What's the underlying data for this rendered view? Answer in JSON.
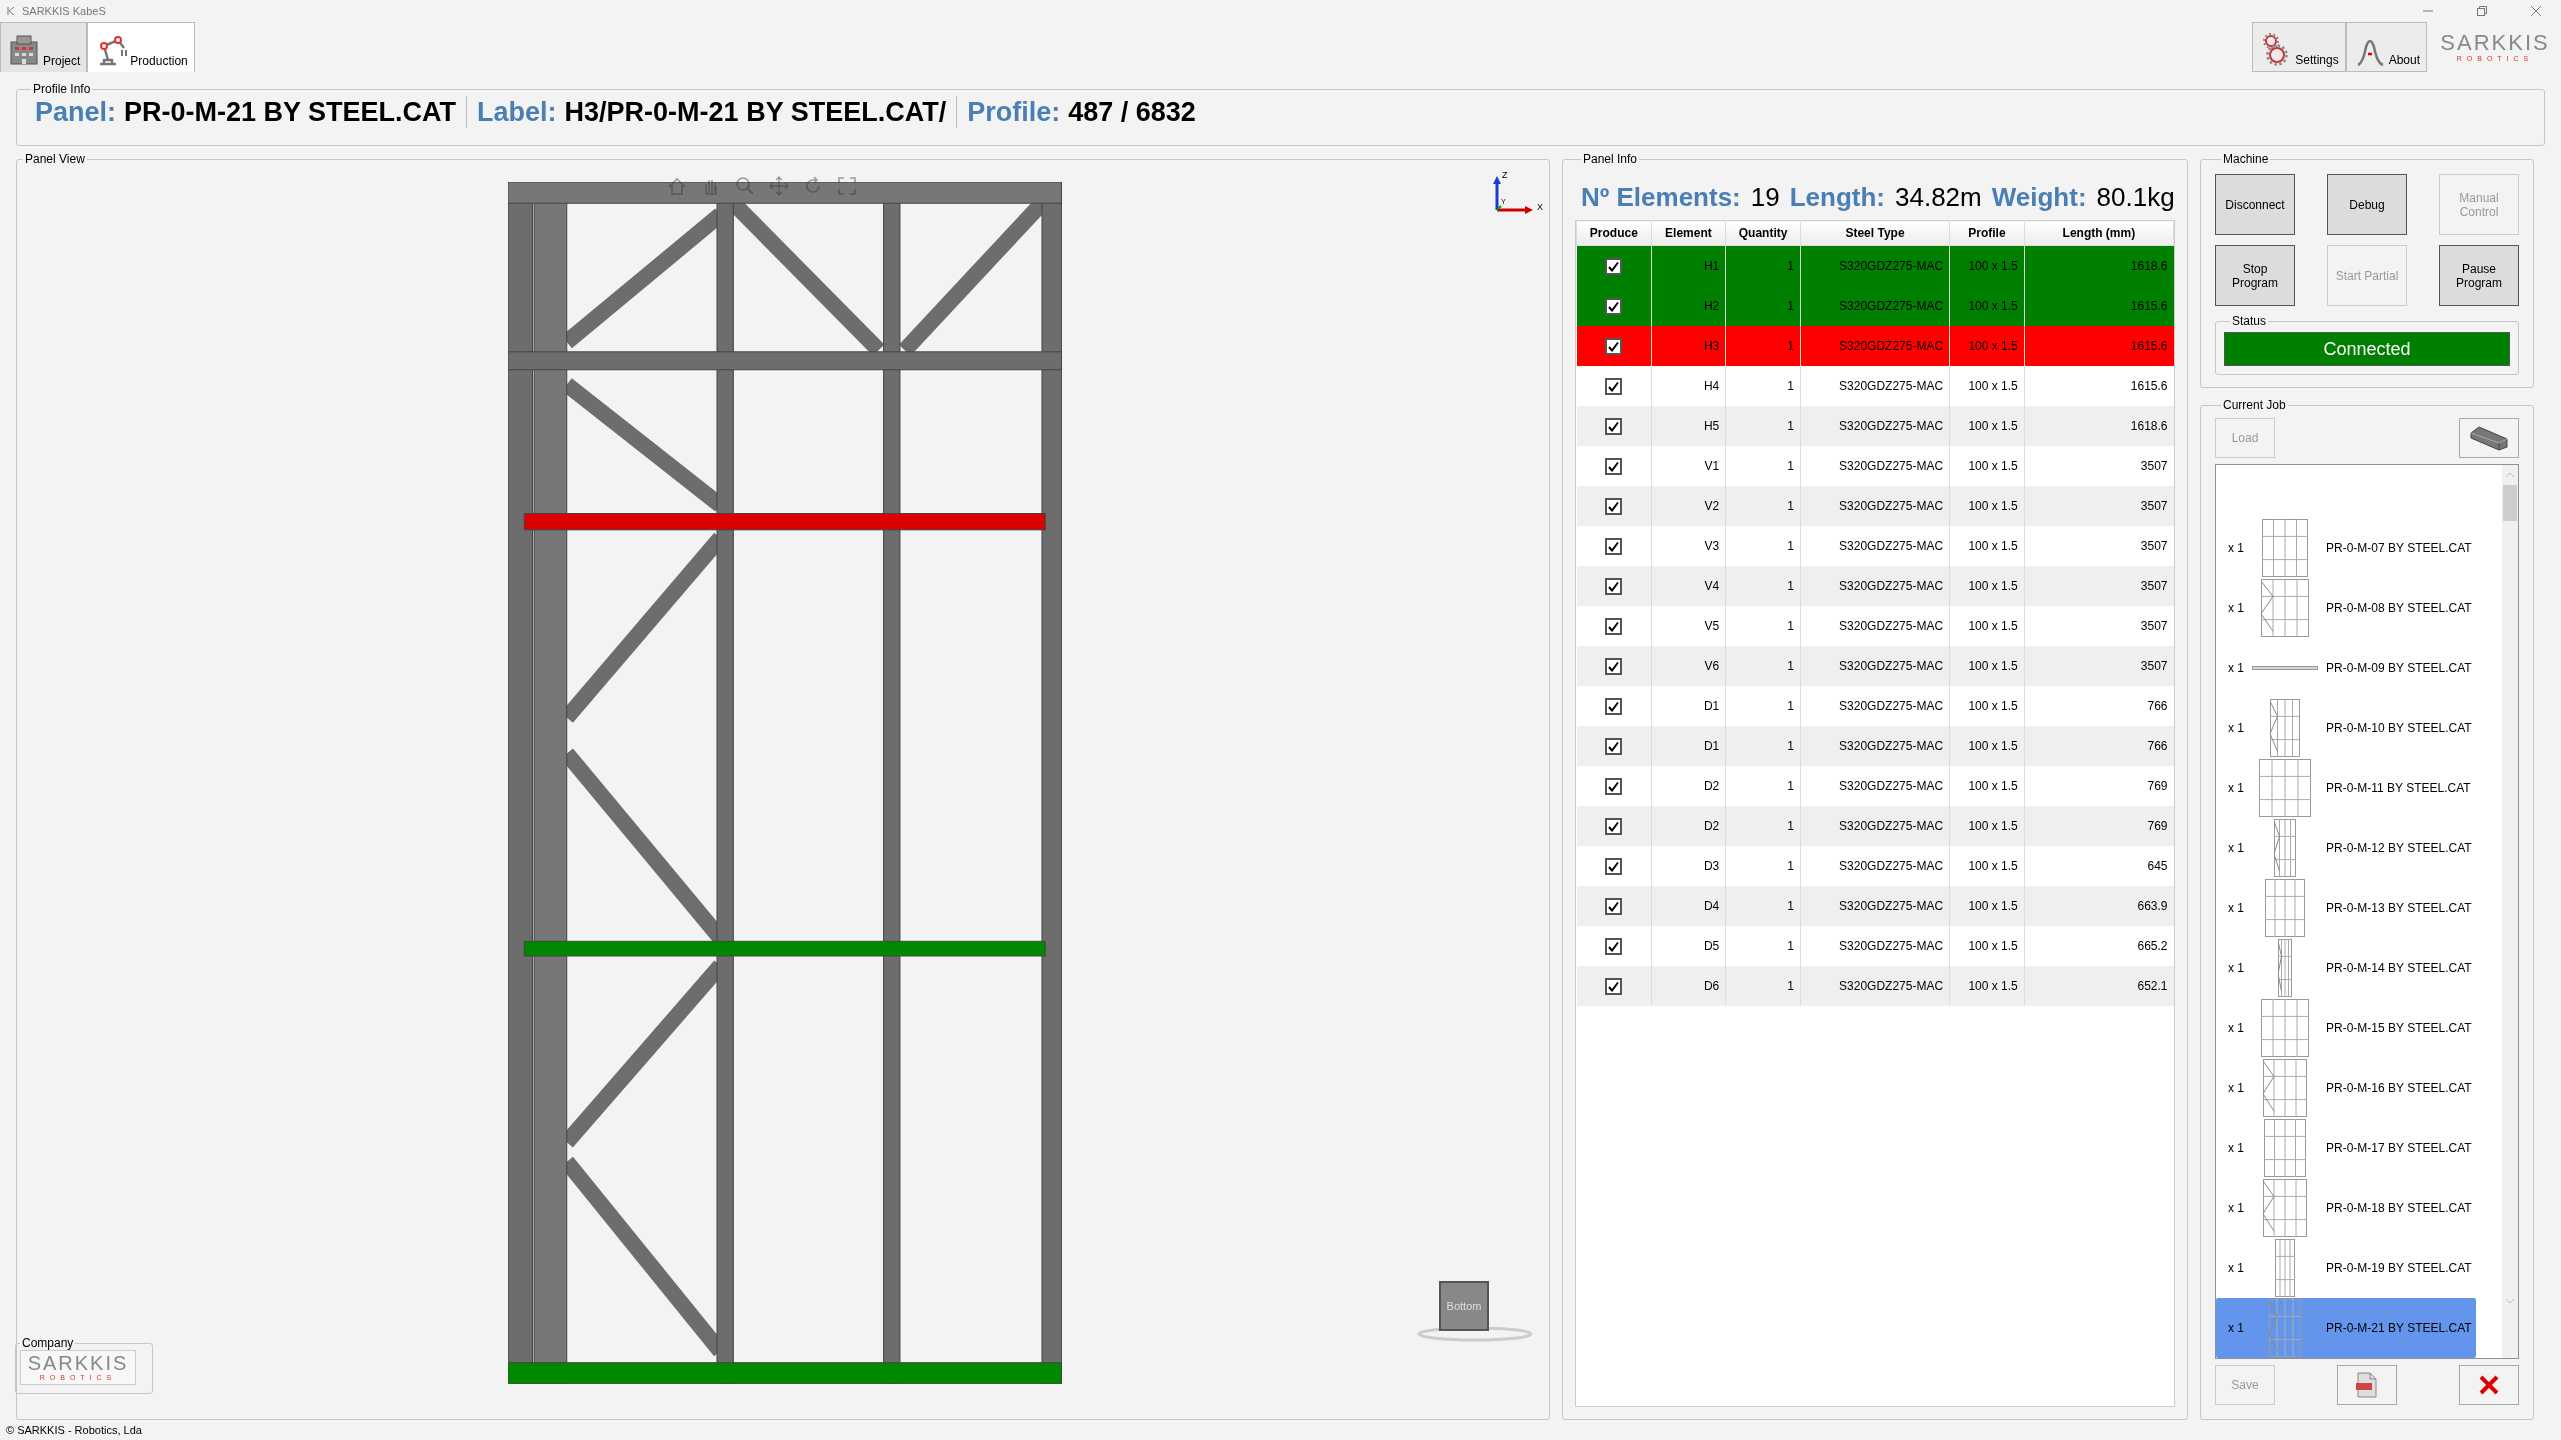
{
  "window": {
    "title": "SARKKIS KabeS"
  },
  "tabs": [
    {
      "label": "Project",
      "kind": "project",
      "selected": false
    },
    {
      "label": "Production",
      "kind": "production",
      "selected": true
    }
  ],
  "toolbar_buttons": [
    {
      "label": "Settings",
      "kind": "settings"
    },
    {
      "label": "About",
      "kind": "about"
    }
  ],
  "logo": {
    "name": "SARKKIS",
    "tagline": "ROBOTICS"
  },
  "profile_info": {
    "title": "Profile Info",
    "fields": [
      {
        "label": "Panel:",
        "value": "PR-0-M-21 BY STEEL.CAT"
      },
      {
        "label": "Label:",
        "value": "H3/PR-0-M-21 BY STEEL.CAT/"
      },
      {
        "label": "Profile:",
        "value": "487 / 6832"
      }
    ]
  },
  "panel_view": {
    "title": "Panel View",
    "axes": {
      "z": "Z",
      "y": "Y",
      "x": "X"
    },
    "view_cube": "Bottom"
  },
  "company": {
    "title": "Company",
    "name": "SARKKIS",
    "tagline": "ROBOTICS"
  },
  "panel_info": {
    "title": "Panel Info",
    "stats": [
      {
        "label": "Nº Elements:",
        "value": "19"
      },
      {
        "label": "Length:",
        "value": "34.82m"
      },
      {
        "label": "Weight:",
        "value": "80.1kg"
      }
    ],
    "columns": [
      "Produce",
      "Element",
      "Quantity",
      "Steel Type",
      "Profile",
      "Length (mm)"
    ],
    "rows": [
      {
        "checked": true,
        "element": "H1",
        "quantity": "1",
        "steel_type": "S320GDZ275-MAC",
        "profile": "100 x 1.5",
        "length": "1618.6",
        "color": "#008000"
      },
      {
        "checked": true,
        "element": "H2",
        "quantity": "1",
        "steel_type": "S320GDZ275-MAC",
        "profile": "100 x 1.5",
        "length": "1615.6",
        "color": "#008000"
      },
      {
        "checked": true,
        "element": "H3",
        "quantity": "1",
        "steel_type": "S320GDZ275-MAC",
        "profile": "100 x 1.5",
        "length": "1615.6",
        "color": "#ff0000"
      },
      {
        "checked": true,
        "element": "H4",
        "quantity": "1",
        "steel_type": "S320GDZ275-MAC",
        "profile": "100 x 1.5",
        "length": "1615.6"
      },
      {
        "checked": true,
        "element": "H5",
        "quantity": "1",
        "steel_type": "S320GDZ275-MAC",
        "profile": "100 x 1.5",
        "length": "1618.6"
      },
      {
        "checked": true,
        "element": "V1",
        "quantity": "1",
        "steel_type": "S320GDZ275-MAC",
        "profile": "100 x 1.5",
        "length": "3507"
      },
      {
        "checked": true,
        "element": "V2",
        "quantity": "1",
        "steel_type": "S320GDZ275-MAC",
        "profile": "100 x 1.5",
        "length": "3507"
      },
      {
        "checked": true,
        "element": "V3",
        "quantity": "1",
        "steel_type": "S320GDZ275-MAC",
        "profile": "100 x 1.5",
        "length": "3507"
      },
      {
        "checked": true,
        "element": "V4",
        "quantity": "1",
        "steel_type": "S320GDZ275-MAC",
        "profile": "100 x 1.5",
        "length": "3507"
      },
      {
        "checked": true,
        "element": "V5",
        "quantity": "1",
        "steel_type": "S320GDZ275-MAC",
        "profile": "100 x 1.5",
        "length": "3507"
      },
      {
        "checked": true,
        "element": "V6",
        "quantity": "1",
        "steel_type": "S320GDZ275-MAC",
        "profile": "100 x 1.5",
        "length": "3507"
      },
      {
        "checked": true,
        "element": "D1",
        "quantity": "1",
        "steel_type": "S320GDZ275-MAC",
        "profile": "100 x 1.5",
        "length": "766"
      },
      {
        "checked": true,
        "element": "D1",
        "quantity": "1",
        "steel_type": "S320GDZ275-MAC",
        "profile": "100 x 1.5",
        "length": "766"
      },
      {
        "checked": true,
        "element": "D2",
        "quantity": "1",
        "steel_type": "S320GDZ275-MAC",
        "profile": "100 x 1.5",
        "length": "769"
      },
      {
        "checked": true,
        "element": "D2",
        "quantity": "1",
        "steel_type": "S320GDZ275-MAC",
        "profile": "100 x 1.5",
        "length": "769"
      },
      {
        "checked": true,
        "element": "D3",
        "quantity": "1",
        "steel_type": "S320GDZ275-MAC",
        "profile": "100 x 1.5",
        "length": "645"
      },
      {
        "checked": true,
        "element": "D4",
        "quantity": "1",
        "steel_type": "S320GDZ275-MAC",
        "profile": "100 x 1.5",
        "length": "663.9"
      },
      {
        "checked": true,
        "element": "D5",
        "quantity": "1",
        "steel_type": "S320GDZ275-MAC",
        "profile": "100 x 1.5",
        "length": "665.2"
      },
      {
        "checked": true,
        "element": "D6",
        "quantity": "1",
        "steel_type": "S320GDZ275-MAC",
        "profile": "100 x 1.5",
        "length": "652.1"
      }
    ]
  },
  "machine": {
    "title": "Machine",
    "buttons": [
      {
        "label": "Disconnect",
        "disabled": false
      },
      {
        "label": "Debug",
        "disabled": false
      },
      {
        "label": "Manual Control",
        "disabled": true
      },
      {
        "label": "Stop Program",
        "disabled": false
      },
      {
        "label": "Start Partial",
        "disabled": true
      },
      {
        "label": "Pause Program",
        "disabled": false
      }
    ],
    "status": {
      "title": "Status",
      "text": "Connected",
      "connected": true
    }
  },
  "current_job": {
    "title": "Current Job",
    "load_button": {
      "label": "Load",
      "disabled": true
    },
    "items": [
      {
        "quantity": "x 1",
        "name": "PR-0-M-07 BY STEEL.CAT",
        "selected": false
      },
      {
        "quantity": "x 1",
        "name": "PR-0-M-08 BY STEEL.CAT",
        "selected": false
      },
      {
        "quantity": "x 1",
        "name": "PR-0-M-09 BY STEEL.CAT",
        "selected": false
      },
      {
        "quantity": "x 1",
        "name": "PR-0-M-10 BY STEEL.CAT",
        "selected": false
      },
      {
        "quantity": "x 1",
        "name": "PR-0-M-11 BY STEEL.CAT",
        "selected": false
      },
      {
        "quantity": "x 1",
        "name": "PR-0-M-12 BY STEEL.CAT",
        "selected": false
      },
      {
        "quantity": "x 1",
        "name": "PR-0-M-13 BY STEEL.CAT",
        "selected": false
      },
      {
        "quantity": "x 1",
        "name": "PR-0-M-14 BY STEEL.CAT",
        "selected": false
      },
      {
        "quantity": "x 1",
        "name": "PR-0-M-15 BY STEEL.CAT",
        "selected": false
      },
      {
        "quantity": "x 1",
        "name": "PR-0-M-16 BY STEEL.CAT",
        "selected": false
      },
      {
        "quantity": "x 1",
        "name": "PR-0-M-17 BY STEEL.CAT",
        "selected": false
      },
      {
        "quantity": "x 1",
        "name": "PR-0-M-18 BY STEEL.CAT",
        "selected": false
      },
      {
        "quantity": "x 1",
        "name": "PR-0-M-19 BY STEEL.CAT",
        "selected": false
      },
      {
        "quantity": "x 1",
        "name": "PR-0-M-21 BY STEEL.CAT",
        "selected": true
      }
    ],
    "save_button": {
      "label": "Save",
      "disabled": true
    }
  },
  "footer": "© SARKKIS - Robotics, Lda"
}
